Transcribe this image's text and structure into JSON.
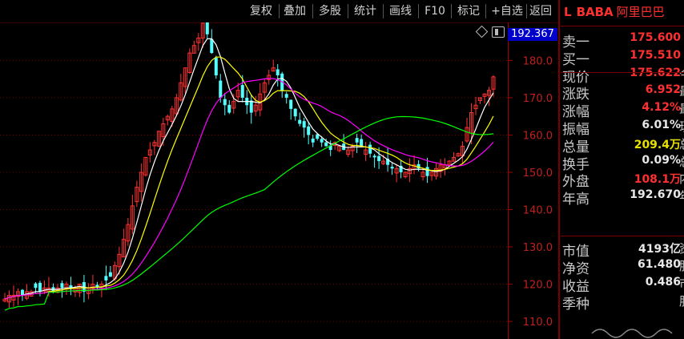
{
  "toolbar": {
    "buttons": [
      "复权",
      "叠加",
      "多股",
      "统计",
      "画线",
      "F10",
      "标记",
      "+自选",
      "返回"
    ]
  },
  "stock": {
    "mark": "L",
    "symbol": "BABA",
    "name": "阿里巴巴"
  },
  "quote": [
    {
      "label": "卖一",
      "value": "175.600",
      "color": "#ff3030",
      "tail": ""
    },
    {
      "label": "买一",
      "value": "175.510",
      "color": "#ff3030",
      "tail": ""
    },
    {
      "label": "现价",
      "value": "175.622",
      "color": "#ff3030",
      "tail": "今"
    },
    {
      "label": "涨跌",
      "value": "6.952",
      "color": "#ff3030",
      "tail": "最"
    },
    {
      "label": "涨幅",
      "value": "4.12%",
      "color": "#ff3030",
      "tail": "最"
    },
    {
      "label": "振幅",
      "value": "6.01%",
      "color": "#e8e8e8",
      "tail": "现"
    },
    {
      "label": "总量",
      "value": "209.4万",
      "color": "#e8e000",
      "tail": "总"
    },
    {
      "label": "换手",
      "value": "0.09%",
      "color": "#e8e8e8",
      "tail": "总"
    },
    {
      "label": "外盘",
      "value": "108.1万",
      "color": "#ff3030",
      "tail": "内"
    },
    {
      "label": "年高",
      "value": "192.670",
      "color": "#e8e8e8",
      "tail": "年"
    }
  ],
  "fundamentals": [
    {
      "label": "市值",
      "value": "4193亿",
      "color": "#e8e8e8",
      "tail": "资"
    },
    {
      "label": "净资",
      "value": "61.480",
      "color": "#e8e8e8",
      "tail": "股"
    },
    {
      "label": "收益",
      "value": "0.486",
      "color": "#e8e8e8",
      "tail": "市"
    },
    {
      "label": "季种",
      "value": "",
      "color": "#e8e8e8",
      "tail": "股"
    }
  ],
  "price_tag": "192.367",
  "chart_data": {
    "type": "candlestick",
    "y_ticks": [
      110,
      120,
      130,
      140,
      150,
      160,
      170,
      180
    ],
    "ylim": [
      105.3,
      196.2
    ],
    "y_tick_labels": [
      "110.0",
      "120.0",
      "130.0",
      "140.0",
      "150.0",
      "160.0",
      "170.0",
      "180.0"
    ],
    "peak_label": "192.670",
    "up_color": "#ff3232",
    "down_color": "#54ffff",
    "grid": "dotted-horizontal",
    "ma_colors": [
      "#ffffff",
      "#ffff00",
      "#ff00ff",
      "#00ff00"
    ],
    "closes": [
      116,
      117,
      117,
      118,
      117,
      118,
      118,
      119,
      118,
      119,
      119,
      118,
      119,
      119,
      120,
      119,
      119,
      120,
      118,
      119,
      120,
      119,
      120,
      121,
      122,
      125,
      128,
      132,
      136,
      141,
      146,
      150,
      154,
      156,
      158,
      161,
      163,
      165,
      167,
      170,
      174,
      178,
      182,
      184,
      186,
      190,
      187,
      182,
      176,
      170,
      168,
      166,
      169,
      172,
      170,
      168,
      166,
      168,
      171,
      174,
      176,
      178,
      176,
      172,
      170,
      167,
      165,
      163,
      162,
      160,
      158,
      159,
      158,
      157,
      156,
      158,
      157,
      156,
      156,
      157,
      158,
      157,
      156,
      155,
      154,
      153,
      153,
      152,
      151,
      151,
      150,
      150,
      151,
      152,
      151,
      150,
      149,
      150,
      151,
      152,
      152,
      153,
      154,
      155,
      157,
      162,
      166,
      168,
      170,
      171,
      172,
      175.6
    ]
  }
}
